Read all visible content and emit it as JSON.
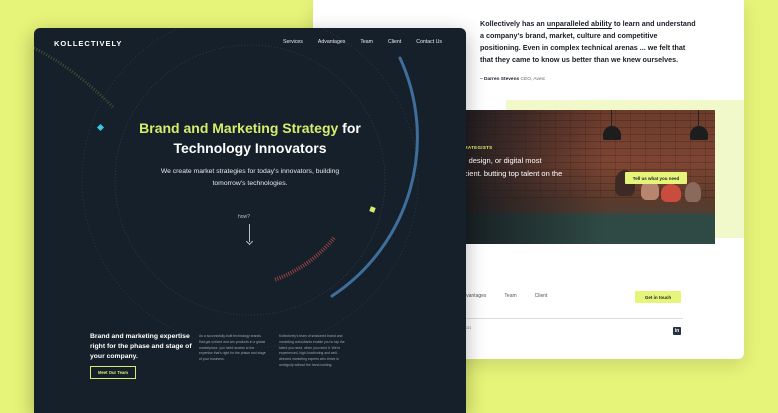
{
  "back_page": {
    "quote": {
      "part1": "Kollectively has an ",
      "underlined": "unparalleled ability",
      "part2": " to learn and understand a company's brand, market, culture and competitive positioning. Even in complex technical arenas ... we felt that that they came to know us better than we knew ourselves.",
      "author": "– Darren Stevens",
      "author_role": "CEO, Avetc"
    },
    "strategists_label": "STRATEGISTS",
    "strategists_text": "ent, design, or digital most efficient. butting top talent on the",
    "tell_button": "Tell us what you need",
    "nav": [
      "Advantages",
      "Team",
      "Client"
    ],
    "touch_button": "Get in touch",
    "copyright": "© 2021",
    "linkedin_glyph": "in"
  },
  "header": {
    "logo": "KOLLECTIVELY",
    "nav": [
      "Services",
      "Advantages",
      "Team",
      "Client",
      "Contact Us"
    ]
  },
  "hero": {
    "title_accent": "Brand and Marketing Strategy",
    "title_rest1": " for",
    "title_line2": "Technology Innovators",
    "subtitle": "We create market strategies for today's innovators, building tomorrow's technologies.",
    "how_label": "how?"
  },
  "bottom": {
    "heading": "Brand and marketing expertise right for the phase and stage of your company.",
    "button": "Meet Our Team",
    "col1": "As a successfully-built technology brands that get noticed and win products in a global marketplace, you need access to the expertise that's right for the phase and stage of your business.",
    "col2": "Kollectively's team of seasoned brand and marketing consultants enable you to tap the talent you need, when you need it. We're experienced, high-functioning and well-directed marketing experts who thrive in ambiguity without the hand-holding."
  },
  "colors": {
    "background": "#e6f479",
    "dark": "#16202b",
    "accent": "#d6ed6d",
    "arc": "#3f6e9c"
  }
}
